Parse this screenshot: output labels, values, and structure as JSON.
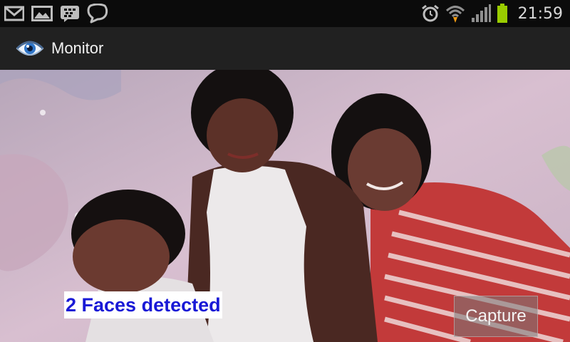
{
  "status_bar": {
    "notification_icons": [
      "gmail-icon",
      "gallery-icon",
      "bbm-icon",
      "talk-bubble-icon"
    ],
    "system_icons": [
      "alarm-icon",
      "wifi-icon",
      "signal-icon",
      "battery-icon"
    ],
    "time": "21:59"
  },
  "action_bar": {
    "app_icon": "eye-icon",
    "title": "Monitor"
  },
  "preview": {
    "faces_label": "2 Faces detected",
    "capture_label": "Capture"
  },
  "colors": {
    "status_bar_bg": "#0b0b0b",
    "action_bar_bg": "#212121",
    "faces_text": "#1919d6",
    "battery": "#99cc00"
  }
}
